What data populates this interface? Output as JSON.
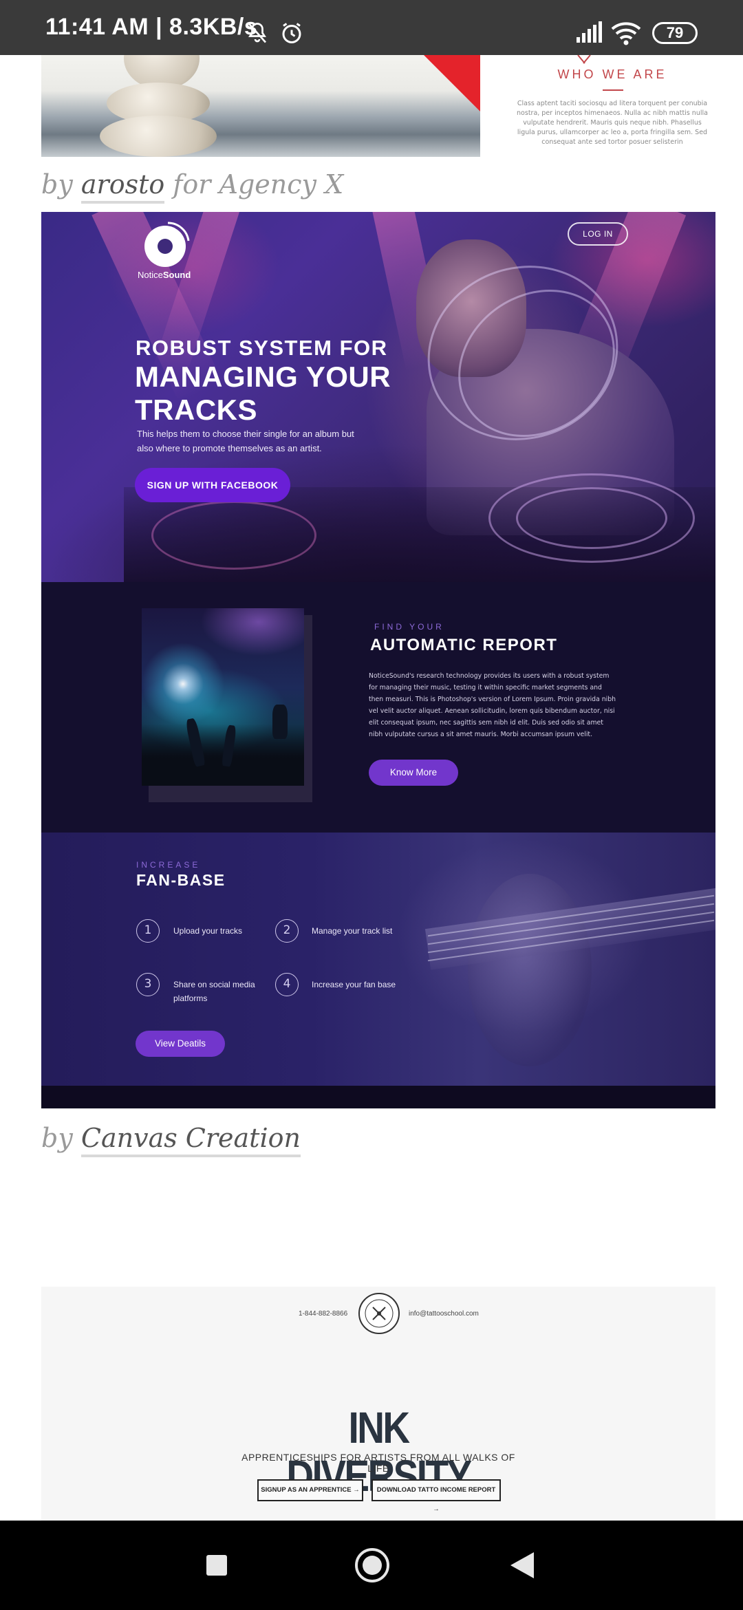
{
  "status_bar": {
    "time_speed": "11:41 AM | 8.3KB/s",
    "battery": "79"
  },
  "previous_showcase": {
    "who_title": "WHO WE ARE",
    "who_text": "Class aptent taciti sociosqu ad litera torquent per conubia nostra, per inceptos himenaeos. Nulla ac nibh mattis nulla vulputate hendrerit. Mauris quis neque nibh. Phasellus ligula purus, ullamcorper ac leo a, porta fringilla sem. Sed consequat ante sed tortor posuer selisterin",
    "credit": {
      "by": "by",
      "author": "arosto",
      "suffix": "for Agency X"
    }
  },
  "noticesound": {
    "logo_prefix": "Notice",
    "logo_bold": "Sound",
    "login": "LOG IN",
    "headline_small": "ROBUST SYSTEM FOR",
    "headline_line2": "MANAGING YOUR",
    "headline_line3": "TRACKS",
    "subtext": "This helps them to choose their single for an album but also where to promote themselves as an artist.",
    "signup_button": "SIGN UP WITH FACEBOOK",
    "report": {
      "eyebrow": "FIND YOUR",
      "title": "AUTOMATIC REPORT",
      "body": "NoticeSound's research technology provides its users with a robust system for managing their music, testing it within specific market segments and then measuri. This is Photoshop's version  of Lorem Ipsum. Proin gravida nibh vel velit auctor aliquet. Aenean sollicitudin, lorem quis bibendum auctor, nisi elit consequat ipsum, nec sagittis sem nibh id elit. Duis sed odio sit amet nibh vulputate cursus a sit amet mauris. Morbi accumsan ipsum velit.",
      "button": "Know More"
    },
    "fanbase": {
      "eyebrow": "INCREASE",
      "title": "FAN-BASE",
      "steps": [
        {
          "num": "1",
          "label": "Upload your tracks"
        },
        {
          "num": "2",
          "label": "Manage your track list"
        },
        {
          "num": "3",
          "label": "Share on social media platforms"
        },
        {
          "num": "4",
          "label": "Increase your fan base"
        }
      ],
      "button": "View Deatils"
    },
    "credit": {
      "by": "by",
      "author": "Canvas Creation"
    }
  },
  "ink_diversity": {
    "phone": "1-844-882-8866",
    "email": "info@tattooschool.com",
    "title": "INK DIVERSITY",
    "subtitle": "APPRENTICESHIPS FOR ARTISTS FROM ALL WALKS OF LIFE",
    "button_apprentice": "SIGNUP AS AN APPRENTICE →",
    "button_report": "DOWNLOAD TATTO INCOME REPORT →"
  },
  "colors": {
    "accent_purple": "#7236cc",
    "facebook_button": "#6a1fd6",
    "who_red": "#c2464a"
  }
}
